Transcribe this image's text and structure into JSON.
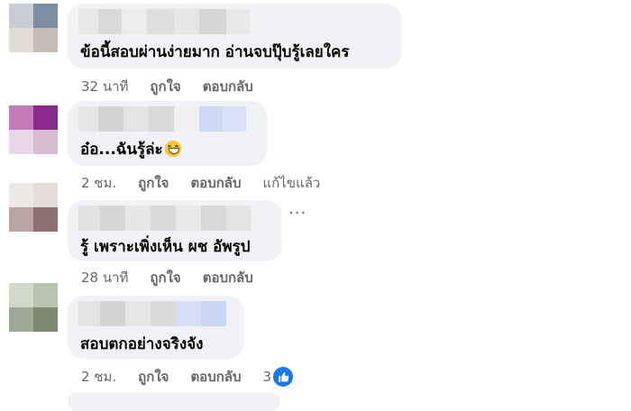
{
  "comments": [
    {
      "text": "ข้อนี้สอบผ่านง่ายมาก อ่านจบปุ๊บรู้เลยใคร",
      "time": "32 นาที",
      "like": "ถูกใจ",
      "reply": "ตอบกลับ",
      "edited": "",
      "avatar_colors": [
        "#c8cdd4",
        "#7b8ea3",
        "#e2ddd3",
        "#c5bdb3"
      ]
    },
    {
      "text": "อ๋อ...ฉันรู้ล่ะ",
      "time": "2 ชม.",
      "like": "ถูกใจ",
      "reply": "ตอบกลับ",
      "edited": "แก้ไขแล้ว",
      "avatar_colors": [
        "#c27bb8",
        "#8a2a8c",
        "#e8d7e4",
        "#d7bdd2"
      ]
    },
    {
      "text": "รู้ เพราะเพิ่งเห็น ผช อัพรูป",
      "time": "28 นาที",
      "like": "ถูกใจ",
      "reply": "ตอบกลับ",
      "edited": "",
      "avatar_colors": [
        "#ece8e6",
        "#d7cbc8",
        "#b9a6a3",
        "#8c726f"
      ]
    },
    {
      "text": "สอบตกอย่างจริงจัง",
      "time": "2 ชม.",
      "like": "ถูกใจ",
      "reply": "ตอบกลับ",
      "edited": "",
      "reactions": "3",
      "avatar_colors": [
        "#d2d9ca",
        "#b9c4ae",
        "#9daa93",
        "#7b8a6e"
      ]
    }
  ],
  "icons": {
    "emoji": "grinning-face-icon",
    "reaction": "thumbs-up-icon",
    "more": "more-dots-icon"
  },
  "colors": {
    "bubble": "#f0f2f5",
    "meta": "#65676b",
    "like_blue": "#1877f2"
  }
}
